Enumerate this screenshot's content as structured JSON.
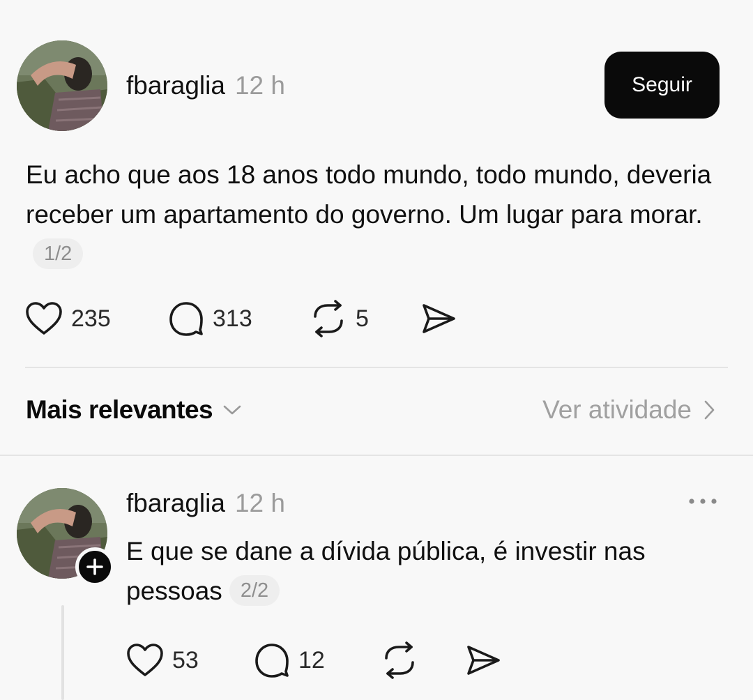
{
  "post": {
    "username": "fbaraglia",
    "time": "12 h",
    "follow_label": "Seguir",
    "text": "Eu acho que aos 18 anos todo mundo, todo mundo, deveria receber um apartamento do governo. Um lugar para morar.",
    "page_indicator": "1/2",
    "likes": "235",
    "comments": "313",
    "reposts": "5"
  },
  "sort": {
    "label": "Mais relevantes",
    "activity_label": "Ver atividade"
  },
  "reply": {
    "username": "fbaraglia",
    "time": "12 h",
    "text": "E que se dane a dívida pública, é investir nas pessoas",
    "page_indicator": "2/2",
    "likes": "53",
    "comments": "12"
  },
  "icons": {
    "like": "heart-icon",
    "comment": "comment-bubble-icon",
    "repost": "repost-icon",
    "share": "share-send-icon",
    "more": "more-dots-icon",
    "sort_chevron": "chevron-down-icon",
    "activity_chevron": "chevron-right-icon",
    "add": "plus-icon"
  },
  "colors": {
    "background": "#f8f8f8",
    "button": "#0a0a0a",
    "muted_text": "#9b9b9b"
  }
}
